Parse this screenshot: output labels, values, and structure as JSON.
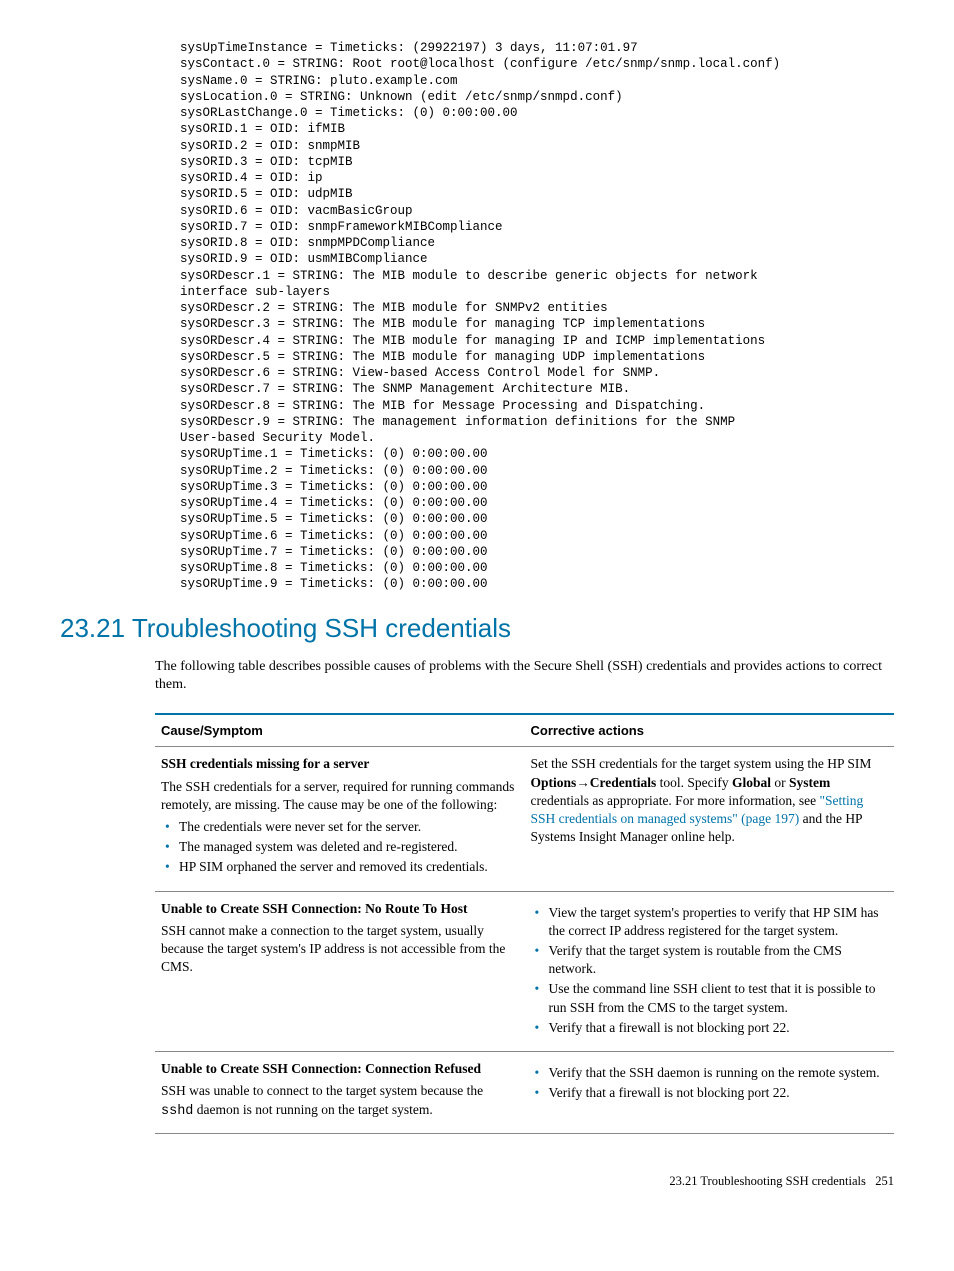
{
  "code_block": "sysUpTimeInstance = Timeticks: (29922197) 3 days, 11:07:01.97\nsysContact.0 = STRING: Root root@localhost (configure /etc/snmp/snmp.local.conf)\nsysName.0 = STRING: pluto.example.com\nsysLocation.0 = STRING: Unknown (edit /etc/snmp/snmpd.conf)\nsysORLastChange.0 = Timeticks: (0) 0:00:00.00\nsysORID.1 = OID: ifMIB\nsysORID.2 = OID: snmpMIB\nsysORID.3 = OID: tcpMIB\nsysORID.4 = OID: ip\nsysORID.5 = OID: udpMIB\nsysORID.6 = OID: vacmBasicGroup\nsysORID.7 = OID: snmpFrameworkMIBCompliance\nsysORID.8 = OID: snmpMPDCompliance\nsysORID.9 = OID: usmMIBCompliance\nsysORDescr.1 = STRING: The MIB module to describe generic objects for network\ninterface sub-layers\nsysORDescr.2 = STRING: The MIB module for SNMPv2 entities\nsysORDescr.3 = STRING: The MIB module for managing TCP implementations\nsysORDescr.4 = STRING: The MIB module for managing IP and ICMP implementations\nsysORDescr.5 = STRING: The MIB module for managing UDP implementations\nsysORDescr.6 = STRING: View-based Access Control Model for SNMP.\nsysORDescr.7 = STRING: The SNMP Management Architecture MIB.\nsysORDescr.8 = STRING: The MIB for Message Processing and Dispatching.\nsysORDescr.9 = STRING: The management information definitions for the SNMP\nUser-based Security Model.\nsysORUpTime.1 = Timeticks: (0) 0:00:00.00\nsysORUpTime.2 = Timeticks: (0) 0:00:00.00\nsysORUpTime.3 = Timeticks: (0) 0:00:00.00\nsysORUpTime.4 = Timeticks: (0) 0:00:00.00\nsysORUpTime.5 = Timeticks: (0) 0:00:00.00\nsysORUpTime.6 = Timeticks: (0) 0:00:00.00\nsysORUpTime.7 = Timeticks: (0) 0:00:00.00\nsysORUpTime.8 = Timeticks: (0) 0:00:00.00\nsysORUpTime.9 = Timeticks: (0) 0:00:00.00",
  "section": {
    "number": "23.21",
    "title": "Troubleshooting SSH credentials",
    "intro": "The following table describes possible causes of problems with the Secure Shell (SSH) credentials and provides actions to correct them."
  },
  "table": {
    "headers": {
      "left": "Cause/Symptom",
      "right": "Corrective actions"
    },
    "rows": [
      {
        "cause_title": "SSH credentials missing for a server",
        "cause_body": "The SSH credentials for a server, required for running commands remotely, are missing. The cause may be one of the following:",
        "cause_bullets": [
          "The credentials were never set for the server.",
          "The managed system was deleted and re-registered.",
          "HP SIM orphaned the server and removed its credentials."
        ],
        "action_pre": "Set the SSH credentials for the target system using the HP SIM ",
        "action_bold1": "Options",
        "action_arrow": "→",
        "action_bold2": "Credentials",
        "action_mid1": " tool. Specify ",
        "action_bold3": "Global",
        "action_mid2": " or ",
        "action_bold4": "System",
        "action_mid3": " credentials as appropriate. For more information, see ",
        "action_link": "\"Setting SSH credentials on managed systems\" (page 197)",
        "action_post": " and the HP Systems Insight Manager online help."
      },
      {
        "cause_title": "Unable to Create SSH Connection: No Route To Host",
        "cause_body": "SSH cannot make a connection to the target system, usually because the target system's IP address is not accessible from the CMS.",
        "action_bullets": [
          "View the target system's properties to verify that HP SIM has the correct IP address registered for the target system.",
          "Verify that the target system is routable from the CMS network.",
          "Use the command line SSH client to test that it is possible to run SSH from the CMS to the target system.",
          "Verify that a firewall is not blocking port 22."
        ]
      },
      {
        "cause_title": "Unable to Create SSH Connection: Connection Refused",
        "cause_body_pre": "SSH was unable to connect to the target system because the ",
        "cause_body_mono": "sshd",
        "cause_body_post": " daemon is not running on the target system.",
        "action_bullets": [
          "Verify that the SSH daemon is running on the remote system.",
          "Verify that a firewall is not blocking port 22."
        ]
      }
    ]
  },
  "footer": {
    "text": "23.21 Troubleshooting SSH credentials",
    "page": "251"
  }
}
